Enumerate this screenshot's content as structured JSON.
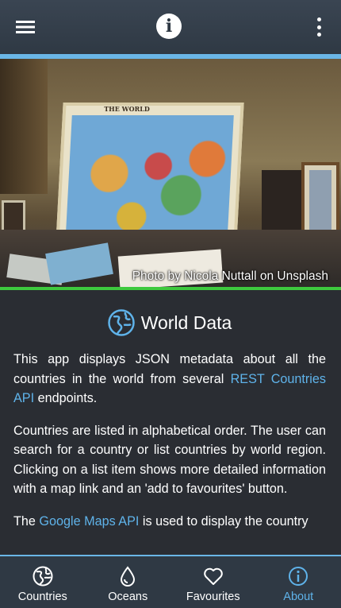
{
  "appbar": {
    "menu_icon": "menu-icon",
    "center_icon": "info-icon",
    "center_glyph": "i",
    "overflow_icon": "more-vert-icon"
  },
  "hero": {
    "credit": "Photo by Nicola Nuttall on Unsplash",
    "map_title": "THE WORLD"
  },
  "content": {
    "title": "World Data",
    "title_icon": "globe-icon",
    "p1_text_a": "This app displays JSON metadata about all the countries in the world from several ",
    "p1_link": "REST Countries API",
    "p1_text_b": " endpoints.",
    "p2": "Countries are listed in alphabetical order. The user can search for a country or list countries by world region. Clicking on a list item shows more detailed information with a map link and an 'add to favourites' button.",
    "p3_text_a": "The ",
    "p3_link": "Google Maps API",
    "p3_text_b": " is used to display the country"
  },
  "tabs": [
    {
      "label": "Countries",
      "icon": "globe-icon",
      "active": false
    },
    {
      "label": "Oceans",
      "icon": "water-drop-icon",
      "active": false
    },
    {
      "label": "Favourites",
      "icon": "heart-icon",
      "active": false
    },
    {
      "label": "About",
      "icon": "info-icon",
      "active": true
    }
  ],
  "colors": {
    "accent": "#5fb3ea",
    "divider_green": "#3ec93e",
    "background": "#2a2d33",
    "bar": "#2f3944"
  }
}
